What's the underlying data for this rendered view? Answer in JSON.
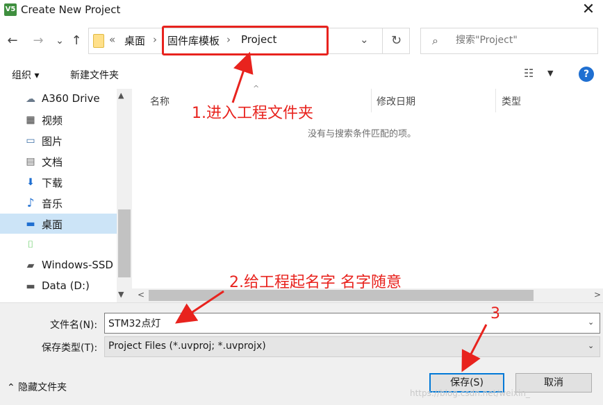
{
  "window": {
    "title": "Create New Project",
    "app_icon_text": "V5",
    "close_glyph": "✕"
  },
  "nav": {
    "back": "←",
    "forward": "→",
    "recent": "⌄",
    "up": "↑",
    "breadcrumb": {
      "overflow": "«",
      "items": [
        "桌面",
        "固件库模板",
        "Project"
      ],
      "sep": "›"
    },
    "address_dropdown": "⌄",
    "refresh": "↻",
    "search_placeholder": "搜索\"Project\"",
    "search_glyph": "⌕"
  },
  "toolbar": {
    "organize": "组织 ▾",
    "new_folder": "新建文件夹",
    "view_glyph": "☷",
    "view_dd": "▼",
    "help": "?"
  },
  "sidebar": {
    "items": [
      {
        "label": "A360 Drive",
        "icon": "☁"
      },
      {
        "label": "视频",
        "icon": "▦"
      },
      {
        "label": "图片",
        "icon": "▭"
      },
      {
        "label": "文档",
        "icon": "▤"
      },
      {
        "label": "下载",
        "icon": "⬇"
      },
      {
        "label": "音乐",
        "icon": "♪"
      },
      {
        "label": "桌面",
        "icon": "▬"
      },
      {
        "label": "",
        "icon": "⌷"
      },
      {
        "label": "Windows-SSD",
        "icon": "▰"
      },
      {
        "label": "Data (D:)",
        "icon": "▬"
      }
    ],
    "scroll_up": "▲",
    "scroll_down": "▼"
  },
  "file_list": {
    "columns": [
      "名称",
      "修改日期",
      "类型"
    ],
    "sort_arrow": "^",
    "empty_message": "没有与搜索条件匹配的项。",
    "scroll_left": "<",
    "scroll_right": ">"
  },
  "bottom": {
    "filename_label": "文件名(N):",
    "filename_value": "STM32点灯",
    "filetype_label": "保存类型(T):",
    "filetype_value": "Project Files (*.uvproj; *.uvprojx)",
    "dropdown_glyph": "⌄",
    "hide_folders": "⌃ 隐藏文件夹",
    "save": "保存(S)",
    "cancel": "取消"
  },
  "annotations": {
    "step1": "1.进入工程文件夹",
    "step2": "2.给工程起名字 名字随意",
    "step3": "3",
    "color": "#e8231e"
  },
  "watermark": "https://blog.csdn.net/weixin_"
}
